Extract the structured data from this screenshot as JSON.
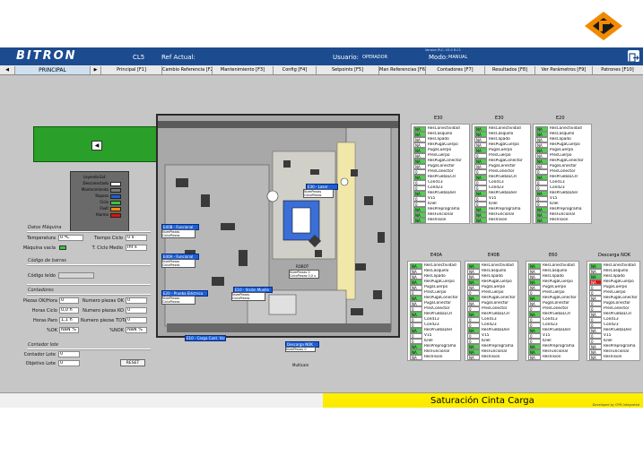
{
  "brand": {
    "logo_text": "BITRON",
    "model": "CL5",
    "ref_label": "Ref Actual:",
    "version": "Version PLC: V3.0 R.C1"
  },
  "user": {
    "label": "Usuario:",
    "value": "OPERADOR"
  },
  "mode": {
    "label": "Modo:",
    "value": "MANUAL"
  },
  "tabs": [
    {
      "label": "PRINCIPAL"
    },
    {
      "label": "Principal [F1]"
    },
    {
      "label": "Cambio Referencia [F2]"
    },
    {
      "label": "Mantenimiento [F3]"
    },
    {
      "label": "Config [F4]"
    },
    {
      "label": "Setpoints [F5]"
    },
    {
      "label": "Man Referencias [F6]"
    },
    {
      "label": "Contadores [F7]"
    },
    {
      "label": "Resultados [F8]"
    },
    {
      "label": "Ver Parámetros [F9]"
    },
    {
      "label": "Patrones [F10]"
    }
  ],
  "legend": {
    "title": "Leyenda Est.",
    "items": [
      {
        "label": "Desconectado",
        "color": "#ffffff"
      },
      {
        "label": "Mantenimiento",
        "color": "#7a7a7a"
      },
      {
        "label": "Reposo",
        "color": "#1a5fd8"
      },
      {
        "label": "Ciclo",
        "color": "#38c738"
      },
      {
        "label": "Fault",
        "color": "#ff8a00"
      },
      {
        "label": "Alarma",
        "color": "#e01010"
      }
    ]
  },
  "datos_maquina": {
    "title": "Datos Máquina",
    "temperatura_label": "Temperatura",
    "temperatura_value": "0 ºC",
    "tiempo_ciclo_label": "Tiempo Ciclo",
    "tiempo_ciclo_value": "0 s",
    "maquina_vacia_label": "Máquina vacía",
    "t_ciclo_medio_label": "T. Ciclo Medio",
    "t_ciclo_medio_value": "Inf s"
  },
  "codigo_barras": {
    "title": "Código de barras",
    "leido_label": "Código leído",
    "leido_value": ""
  },
  "contadores": {
    "title": "Contadores",
    "rows": [
      {
        "l1": "Piezas OK/Hora",
        "v1": "0",
        "l2": "Numero piezas OK",
        "v2": "0"
      },
      {
        "l1": "Horas Ciclo",
        "v1": "0,0 h",
        "l2": "Numero piezas KO",
        "v2": "0"
      },
      {
        "l1": "Horas Paro",
        "v1": "1,1 h",
        "l2": "Numero piezas TOTAL",
        "v2": "0"
      },
      {
        "l1": "%OK",
        "v1": "NaN %",
        "l2": "%NOK",
        "v2": "NaN %"
      }
    ]
  },
  "contador_lote": {
    "title": "Contador lote",
    "lote_label": "Contador Lote",
    "lote_value": "0",
    "objetivo_label": "Objetivo Lote",
    "objetivo_value": "0",
    "reset_label": "RESET"
  },
  "stations": [
    {
      "name": "E30 - Laser"
    },
    {
      "name": "E40B - Funcional"
    },
    {
      "name": "E40A - Funcional"
    },
    {
      "name": "E20 - Prueba Eléctrica"
    },
    {
      "name": "E10 - Visión Muelle"
    },
    {
      "name": "E10 - Carga Cont. Vsn"
    },
    {
      "name": "ROBOT"
    },
    {
      "name": "Descarga NOK"
    }
  ],
  "station_fields": {
    "num_piezas": "NumPiezas",
    "ciclo_piezas": "CicloPiezas",
    "zero": "0,0 s"
  },
  "station_extra": {
    "robot_num": "0",
    "nok_num": "0",
    "robot_ciclo": "0,0 s"
  },
  "plano_label": "Multicam",
  "panels": [
    {
      "title": "E30",
      "rows": [
        {
          "s": "NA",
          "l": "ResConectividad"
        },
        {
          "s": "NA",
          "l": "ResCasquillo"
        },
        {
          "s": "NA",
          "l": "ResClipado"
        },
        {
          "s": "NA",
          "l": "ResPugaCuerpo"
        },
        {
          "s": "NA",
          "l": "PugaCuerpo"
        },
        {
          "s": "NA",
          "l": "PresCuerpo"
        },
        {
          "s": "NA",
          "l": "ResPugaConector"
        },
        {
          "s": "NA",
          "l": "PugaConector"
        },
        {
          "s": "0",
          "l": "PresConector"
        },
        {
          "s": "NA",
          "l": "ResPruebaLCR"
        },
        {
          "s": "0",
          "l": "Cond13"
        },
        {
          "s": "0",
          "l": "Cond23"
        },
        {
          "s": "NA",
          "l": "ResPruebaDiel"
        },
        {
          "s": "0",
          "l": "V15"
        },
        {
          "s": "0",
          "l": "IDiel"
        },
        {
          "s": "NA",
          "l": "ResPreprograma"
        },
        {
          "s": "NA",
          "l": "ResFuncional"
        },
        {
          "s": "NA",
          "l": "ResVision"
        }
      ]
    },
    {
      "title": "E30",
      "rows": [
        {
          "s": "NA",
          "l": "ResConectividad"
        },
        {
          "s": "NA",
          "l": "ResCasquillo"
        },
        {
          "s": "NA",
          "l": "ResClipado"
        },
        {
          "s": "NA",
          "l": "ResPugaCuerpo"
        },
        {
          "s": "NA",
          "l": "PugaCuerpo"
        },
        {
          "s": "0",
          "l": "PresCuerpo"
        },
        {
          "s": "NA",
          "l": "ResPugaConector"
        },
        {
          "s": "NA",
          "l": "PugaConector"
        },
        {
          "s": "0",
          "l": "PresConector"
        },
        {
          "s": "NA",
          "l": "ResPruebaLCR"
        },
        {
          "s": "0",
          "l": "Cond13"
        },
        {
          "s": "0",
          "l": "Cond23"
        },
        {
          "s": "NA",
          "l": "ResPruebaDiel"
        },
        {
          "s": "0",
          "l": "V15"
        },
        {
          "s": "0",
          "l": "IDiel"
        },
        {
          "s": "NA",
          "l": "ResPreprograma"
        },
        {
          "s": "NA",
          "l": "ResFuncional"
        },
        {
          "s": "NA",
          "l": "ResVision"
        }
      ]
    },
    {
      "title": "E20",
      "rows": [
        {
          "s": "NA",
          "l": "ResConectividad"
        },
        {
          "s": "NA",
          "l": "ResCasquillo"
        },
        {
          "s": "NA",
          "l": "ResClipado"
        },
        {
          "s": "NA",
          "l": "ResPugaCuerpo"
        },
        {
          "s": "NA",
          "l": "PugaCuerpo"
        },
        {
          "s": "NA",
          "l": "PresCuerpo"
        },
        {
          "s": "NA",
          "l": "ResPugaConector"
        },
        {
          "s": "NA",
          "l": "PugaConector"
        },
        {
          "s": "0",
          "l": "PresConector"
        },
        {
          "s": "NA",
          "l": "ResPruebaLCR"
        },
        {
          "s": "0",
          "l": "Cond13"
        },
        {
          "s": "0",
          "l": "Cond23"
        },
        {
          "s": "NA",
          "l": "ResPruebaDiel"
        },
        {
          "s": "0",
          "l": "V15"
        },
        {
          "s": "0",
          "l": "IDiel"
        },
        {
          "s": "NA",
          "l": "ResPreprograma"
        },
        {
          "s": "NA",
          "l": "ResFuncional"
        },
        {
          "s": "NA",
          "l": "ResVision"
        }
      ]
    },
    {
      "title": "E40A",
      "rows": [
        {
          "s": "NA",
          "l": "ResConectividad"
        },
        {
          "s": "NA",
          "l": "ResCasquillo"
        },
        {
          "s": "NA",
          "l": "ResClipado"
        },
        {
          "s": "NA",
          "l": "ResPugaCuerpo"
        },
        {
          "s": "NA",
          "l": "PugaCuerpo"
        },
        {
          "s": "0",
          "l": "PresCuerpo"
        },
        {
          "s": "NA",
          "l": "ResPugaConector"
        },
        {
          "s": "NA",
          "l": "PugaConector"
        },
        {
          "s": "0",
          "l": "PresConector"
        },
        {
          "s": "NA",
          "l": "ResPruebaLCR"
        },
        {
          "s": "0",
          "l": "Cond13"
        },
        {
          "s": "0",
          "l": "Cond23"
        },
        {
          "s": "NA",
          "l": "ResPruebaDiel"
        },
        {
          "s": "0",
          "l": "V15"
        },
        {
          "s": "0",
          "l": "IDiel"
        },
        {
          "s": "NA",
          "l": "ResPreprograma"
        },
        {
          "s": "NA",
          "l": "ResFuncional"
        },
        {
          "s": "NA",
          "l": "ResVision"
        }
      ]
    },
    {
      "title": "E40B",
      "rows": [
        {
          "s": "NA",
          "l": "ResConectividad"
        },
        {
          "s": "NA",
          "l": "ResCasquillo"
        },
        {
          "s": "NA",
          "l": "ResClipado"
        },
        {
          "s": "NA",
          "l": "ResPugaCuerpo"
        },
        {
          "s": "NA",
          "l": "PugaCuerpo"
        },
        {
          "s": "0",
          "l": "PresCuerpo"
        },
        {
          "s": "NA",
          "l": "ResPugaConector"
        },
        {
          "s": "NA",
          "l": "PugaConector"
        },
        {
          "s": "0",
          "l": "PresConector"
        },
        {
          "s": "NA",
          "l": "ResPruebaLCR"
        },
        {
          "s": "0",
          "l": "Cond13"
        },
        {
          "s": "0",
          "l": "Cond23"
        },
        {
          "s": "NA",
          "l": "ResPruebaDiel"
        },
        {
          "s": "0",
          "l": "V15"
        },
        {
          "s": "0",
          "l": "IDiel"
        },
        {
          "s": "NA",
          "l": "ResPreprograma"
        },
        {
          "s": "NA",
          "l": "ResFuncional"
        },
        {
          "s": "NA",
          "l": "ResVision"
        }
      ]
    },
    {
      "title": "E60",
      "rows": [
        {
          "s": "NA",
          "l": "ResConectividad"
        },
        {
          "s": "NA",
          "l": "ResCasquillo"
        },
        {
          "s": "NA",
          "l": "ResClipado"
        },
        {
          "s": "NA",
          "l": "ResPugaCuerpo"
        },
        {
          "s": "NA",
          "l": "PugaCuerpo"
        },
        {
          "s": "0",
          "l": "PresCuerpo"
        },
        {
          "s": "NA",
          "l": "ResPugaConector"
        },
        {
          "s": "NA",
          "l": "PugaConector"
        },
        {
          "s": "0",
          "l": "PresConector"
        },
        {
          "s": "NA",
          "l": "ResPruebaLCR"
        },
        {
          "s": "0",
          "l": "Cond13"
        },
        {
          "s": "0",
          "l": "Cond23"
        },
        {
          "s": "NA",
          "l": "ResPruebaDiel"
        },
        {
          "s": "0",
          "l": "V15"
        },
        {
          "s": "0",
          "l": "IDiel"
        },
        {
          "s": "NA",
          "l": "ResPreprograma"
        },
        {
          "s": "NA",
          "l": "ResFuncional"
        },
        {
          "s": "NA",
          "l": "ResVision"
        }
      ]
    },
    {
      "title": "Descarga NOK",
      "rows": [
        {
          "s": "NA",
          "l": "ResConectividad"
        },
        {
          "s": "NA",
          "l": "ResCasquillo"
        },
        {
          "s": "NA",
          "l": "ResClipado"
        },
        {
          "s": "NA",
          "l": "ResPugaCuerpo"
        },
        {
          "s": "0",
          "l": "PugaCuerpo"
        },
        {
          "s": "0",
          "l": "PresCuerpo"
        },
        {
          "s": "NA",
          "l": "ResPugaConector"
        },
        {
          "s": "0",
          "l": "PugaConector"
        },
        {
          "s": "0",
          "l": "PresConector"
        },
        {
          "s": "NA",
          "l": "ResPruebaLCR"
        },
        {
          "s": "0",
          "l": "Cond13"
        },
        {
          "s": "0",
          "l": "Cond23"
        },
        {
          "s": "NA",
          "l": "ResPruebaDiel"
        },
        {
          "s": "0",
          "l": "V15"
        },
        {
          "s": "0",
          "l": "IDiel"
        },
        {
          "s": "NA",
          "l": "ResPreprograma"
        },
        {
          "s": "NA",
          "l": "ResFuncional"
        },
        {
          "s": "NA",
          "l": "ResVision"
        }
      ]
    }
  ],
  "panel_ok_rows": [
    [
      0,
      1,
      4,
      6,
      9,
      12,
      15,
      16,
      17
    ],
    [
      0,
      1,
      4,
      6,
      9,
      12,
      15,
      16,
      17
    ],
    [
      0,
      1,
      4,
      6,
      9,
      12,
      15,
      16,
      17
    ],
    [
      0,
      3,
      6,
      9,
      12,
      15,
      16
    ],
    [
      0,
      3,
      6,
      9,
      12,
      15,
      16
    ],
    [
      0,
      3,
      6,
      9,
      12,
      15,
      16
    ],
    [
      0,
      2
    ]
  ],
  "panel_ng_rows": [
    [],
    [],
    [],
    [],
    [],
    [],
    [
      3
    ]
  ],
  "alarm_message": "Saturación Cinta Carga",
  "footer_credit": "Developed by CPM Integrated"
}
